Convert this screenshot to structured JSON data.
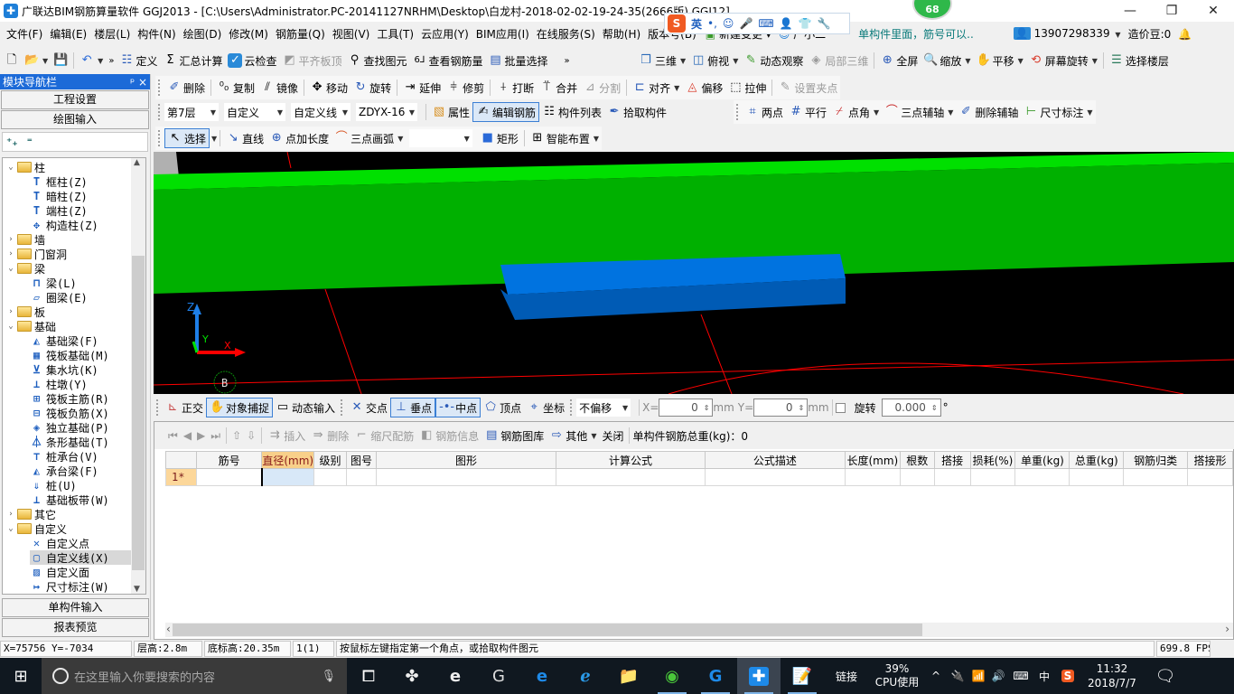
{
  "window": {
    "title": "广联达BIM钢筋算量软件 GGJ2013 - [C:\\Users\\Administrator.PC-20141127NRHM\\Desktop\\白龙村-2018-02-02-19-24-35(2666版).GGJ12]",
    "badge_count": "68",
    "minimize_icon": "—",
    "restore_icon": "❐",
    "close_icon": "✕"
  },
  "ime_toolbar": {
    "logo": "S",
    "lang": "英",
    "punct": "•,",
    "items": [
      "emoji-icon",
      "mic-icon",
      "keyboard-icon",
      "user-icon",
      "shirt-icon",
      "wrench-icon"
    ]
  },
  "menubar": {
    "items": [
      "文件(F)",
      "编辑(E)",
      "楼层(L)",
      "构件(N)",
      "绘图(D)",
      "修改(M)",
      "钢筋量(Q)",
      "视图(V)",
      "工具(T)",
      "云应用(Y)",
      "BIM应用(I)",
      "在线服务(S)",
      "帮助(H)",
      "版本号(B)"
    ],
    "new_change": "新建变更",
    "xiaoguang": "广小二",
    "tip_link": "单构件里面，筋号可以..",
    "user_phone": "13907298339",
    "zaojiadou": "造价豆:0"
  },
  "toolbar1": {
    "left": [
      "定义",
      "汇总计算",
      "云检查",
      "平齐板顶",
      "查找图元",
      "查看钢筋量",
      "批量选择"
    ],
    "right": [
      "三维",
      "俯视",
      "动态观察",
      "局部三维",
      "全屏",
      "缩放",
      "平移",
      "屏幕旋转",
      "选择楼层"
    ]
  },
  "toolbar2": {
    "items": [
      "删除",
      "复制",
      "镜像",
      "移动",
      "旋转",
      "延伸",
      "修剪",
      "打断",
      "合并",
      "分割",
      "对齐",
      "偏移",
      "拉伸",
      "设置夹点"
    ]
  },
  "toolbar3": {
    "floor": "第7层",
    "category": "自定义",
    "type": "自定义线",
    "component": "ZDYX-16",
    "buttons": [
      "属性",
      "编辑钢筋",
      "构件列表",
      "拾取构件"
    ],
    "axis_tools": [
      "两点",
      "平行",
      "点角",
      "三点辅轴",
      "删除辅轴",
      "尺寸标注"
    ]
  },
  "toolbar4": {
    "select": "选择",
    "items": [
      "直线",
      "点加长度",
      "三点画弧",
      "矩形",
      "智能布置"
    ]
  },
  "nav": {
    "title": "模块导航栏",
    "pin": "ᴾ",
    "close": "×",
    "project_settings": "工程设置",
    "drawing_input": "绘图输入",
    "single_input": "单构件输入",
    "report_preview": "报表预览",
    "tree": [
      {
        "label": "柱",
        "type": "folder",
        "open": true,
        "level": 0
      },
      {
        "label": "框柱(Z)",
        "type": "leaf",
        "level": 1,
        "icon": "column-icon"
      },
      {
        "label": "暗柱(Z)",
        "type": "leaf",
        "level": 1,
        "icon": "column-icon"
      },
      {
        "label": "端柱(Z)",
        "type": "leaf",
        "level": 1,
        "icon": "column-icon"
      },
      {
        "label": "构造柱(Z)",
        "type": "leaf",
        "level": 1,
        "icon": "constructional-column-icon"
      },
      {
        "label": "墙",
        "type": "folder",
        "open": false,
        "level": 0
      },
      {
        "label": "门窗洞",
        "type": "folder",
        "open": false,
        "level": 0
      },
      {
        "label": "梁",
        "type": "folder",
        "open": true,
        "level": 0
      },
      {
        "label": "梁(L)",
        "type": "leaf",
        "level": 1,
        "icon": "beam-icon"
      },
      {
        "label": "圈梁(E)",
        "type": "leaf",
        "level": 1,
        "icon": "ring-beam-icon"
      },
      {
        "label": "板",
        "type": "folder",
        "open": false,
        "level": 0
      },
      {
        "label": "基础",
        "type": "folder",
        "open": true,
        "level": 0
      },
      {
        "label": "基础梁(F)",
        "type": "leaf",
        "level": 1,
        "icon": "foundation-beam-icon"
      },
      {
        "label": "筏板基础(M)",
        "type": "leaf",
        "level": 1,
        "icon": "raft-foundation-icon"
      },
      {
        "label": "集水坑(K)",
        "type": "leaf",
        "level": 1,
        "icon": "sump-icon"
      },
      {
        "label": "柱墩(Y)",
        "type": "leaf",
        "level": 1,
        "icon": "column-pier-icon"
      },
      {
        "label": "筏板主筋(R)",
        "type": "leaf",
        "level": 1,
        "icon": "raft-main-rebar-icon"
      },
      {
        "label": "筏板负筋(X)",
        "type": "leaf",
        "level": 1,
        "icon": "raft-negative-rebar-icon"
      },
      {
        "label": "独立基础(P)",
        "type": "leaf",
        "level": 1,
        "icon": "isolated-footing-icon"
      },
      {
        "label": "条形基础(T)",
        "type": "leaf",
        "level": 1,
        "icon": "strip-footing-icon"
      },
      {
        "label": "桩承台(V)",
        "type": "leaf",
        "level": 1,
        "icon": "pile-cap-icon"
      },
      {
        "label": "承台梁(F)",
        "type": "leaf",
        "level": 1,
        "icon": "cap-beam-icon"
      },
      {
        "label": "桩(U)",
        "type": "leaf",
        "level": 1,
        "icon": "pile-icon"
      },
      {
        "label": "基础板带(W)",
        "type": "leaf",
        "level": 1,
        "icon": "foundation-strip-icon"
      },
      {
        "label": "其它",
        "type": "folder",
        "open": false,
        "level": 0
      },
      {
        "label": "自定义",
        "type": "folder",
        "open": true,
        "level": 0
      },
      {
        "label": "自定义点",
        "type": "leaf",
        "level": 1,
        "icon": "custom-point-icon"
      },
      {
        "label": "自定义线(X)",
        "type": "leaf",
        "level": 1,
        "icon": "custom-line-icon",
        "selected": true
      },
      {
        "label": "自定义面",
        "type": "leaf",
        "level": 1,
        "icon": "custom-face-icon"
      },
      {
        "label": "尺寸标注(W)",
        "type": "leaf",
        "level": 1,
        "icon": "dimension-icon"
      }
    ]
  },
  "viewport": {
    "axis_labels": {
      "x": "X",
      "y": "Y",
      "z": "Z"
    },
    "grid_label": "B",
    "colors": {
      "background": "#000000",
      "wall_top": "#00e000",
      "wall_face": "#00b000",
      "beam_top": "#0073e0",
      "beam_face": "#005bb5",
      "gridline": "#ff0000"
    }
  },
  "snapbar": {
    "items": [
      "正交",
      "对象捕捉",
      "动态输入",
      "交点",
      "垂点",
      "中点",
      "顶点",
      "坐标"
    ],
    "offset_mode": "不偏移",
    "x_label": "X=",
    "x_value": "0",
    "y_label": "Y=",
    "y_value": "0",
    "unit": "mm",
    "rotate_label": "旋转",
    "rotate_value": "0.000",
    "degree": "°"
  },
  "rebar_toolbar": {
    "items": [
      "插入",
      "删除",
      "缩尺配筋",
      "钢筋信息",
      "钢筋图库",
      "其他",
      "关闭"
    ],
    "total_weight": "单构件钢筋总重(kg)：0"
  },
  "rebar_table": {
    "columns": [
      "筋号",
      "直径(mm)",
      "级别",
      "图号",
      "图形",
      "计算公式",
      "公式描述",
      "长度(mm)",
      "根数",
      "搭接",
      "损耗(%)",
      "单重(kg)",
      "总重(kg)",
      "钢筋归类",
      "搭接形"
    ],
    "rows": [
      {
        "header": "1*",
        "cells": [
          "",
          "",
          "",
          "",
          "",
          "",
          "",
          "",
          "",
          "",
          "",
          "",
          "",
          "",
          ""
        ]
      }
    ]
  },
  "statusbar": {
    "coords": "X=75756 Y=-7034",
    "floor_height": "层高:2.8m",
    "bottom_elev": "底标高:20.35m",
    "count": "1(1)",
    "hint": "按鼠标左键指定第一个角点，或拾取构件图元",
    "fps": "699.8 FPS"
  },
  "taskbar": {
    "search_placeholder": "在这里输入你要搜索的内容",
    "link": "链接",
    "cpu_percent": "39%",
    "cpu_label": "CPU使用",
    "ime": "中",
    "time": "11:32",
    "date": "2018/7/7"
  }
}
